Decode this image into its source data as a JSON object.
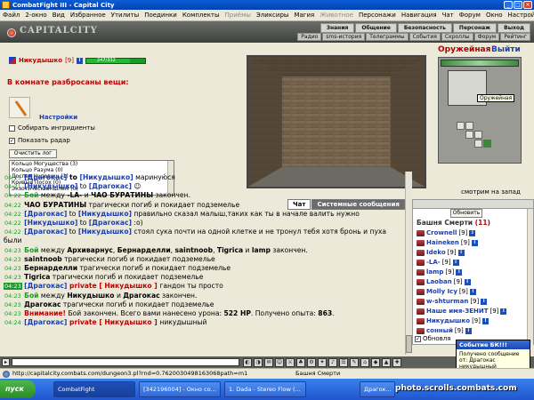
{
  "window": {
    "title": "CombatFight III - Capital City"
  },
  "menu": {
    "items": [
      {
        "label": "Файл",
        "enabled": true
      },
      {
        "label": "2-окно",
        "enabled": true
      },
      {
        "label": "Вид",
        "enabled": true
      },
      {
        "label": "Избранное",
        "enabled": true
      },
      {
        "label": "Утилиты",
        "enabled": true
      },
      {
        "label": "Поединки",
        "enabled": true
      },
      {
        "label": "Комплекты",
        "enabled": true
      },
      {
        "label": "Приёмы",
        "enabled": false
      },
      {
        "label": "Эликсиры",
        "enabled": true
      },
      {
        "label": "Магия",
        "enabled": true
      },
      {
        "label": "Животное",
        "enabled": false
      },
      {
        "label": "Персонажи",
        "enabled": true
      },
      {
        "label": "Навигация",
        "enabled": true
      },
      {
        "label": "Чат",
        "enabled": true
      },
      {
        "label": "Форум",
        "enabled": true
      },
      {
        "label": "Окно",
        "enabled": true
      },
      {
        "label": "Настройки",
        "enabled": true
      }
    ]
  },
  "header": {
    "logo": "CAPITALCITY",
    "nav_top": [
      "Знания",
      "Общение",
      "Безопасность",
      "Персонаж",
      "Выход"
    ],
    "nav_bottom": [
      "Радио",
      "sms-история",
      "Телеграммы",
      "События",
      "Скроллы",
      "Форум",
      "Рейтинг"
    ]
  },
  "player": {
    "name": "Никудышко",
    "level": "[9]",
    "hp_text": "247/332",
    "hp_fraction": 0.744
  },
  "room": {
    "items_title": "В комнате разбросаны вещи:",
    "settings_label": "Настройки",
    "collect_label": "Собирать ингридиенты",
    "radar_label": "Показать радар",
    "clear_log_label": "Очистить лог",
    "items": [
      "Кольцо Могущества (3)",
      "Кольцо Разума (0)",
      "Доспех Чудовищ (1)",
      "Кривый Посох (0)",
      "Экзотический Шлем (0)"
    ]
  },
  "view": {
    "weapon_label": "Оружейная",
    "exit_label": "Выйти",
    "tooltip": "Оружейная",
    "facing": "смотрим на запад"
  },
  "chat": {
    "tabs": [
      "Чат",
      "Системные сообщения"
    ],
    "messages": [
      {
        "time": "04:13",
        "parts": [
          [
            "b",
            "[Драгокас]"
          ],
          [
            "d",
            " to "
          ],
          [
            "b",
            "[Никудышко]"
          ],
          [
            "t",
            " мариную́ся"
          ]
        ]
      },
      {
        "time": "04:21",
        "parts": [
          [
            "b",
            "[Никудышко]"
          ],
          [
            "t",
            " to "
          ],
          [
            "b",
            "[Драгокас]"
          ],
          [
            "t",
            " ☺"
          ]
        ]
      },
      {
        "time": "04:22",
        "parts": [
          [
            "g",
            "Бой"
          ],
          [
            "t",
            " между "
          ],
          [
            "d",
            "-LA-"
          ],
          [
            "t",
            " и "
          ],
          [
            "d",
            "ЧАО БУРАТИНЫ"
          ],
          [
            "t",
            " закончен."
          ]
        ]
      },
      {
        "time": "04:22",
        "parts": [
          [
            "d",
            "ЧАО БУРАТИНЫ"
          ],
          [
            "t",
            " трагически погиб и покидает подземелье"
          ]
        ]
      },
      {
        "time": "04:22",
        "parts": [
          [
            "b",
            "[Драгокас]"
          ],
          [
            "t",
            " to "
          ],
          [
            "b",
            "[Никудышко]"
          ],
          [
            "t",
            " правильно сказал малыш,таких как ты в начале валить нужно"
          ]
        ]
      },
      {
        "time": "04:22",
        "parts": [
          [
            "b",
            "[Никудышко]"
          ],
          [
            "t",
            " to "
          ],
          [
            "b",
            "[Драгокас]"
          ],
          [
            "t",
            " :о)"
          ]
        ]
      },
      {
        "time": "04:22",
        "parts": [
          [
            "b",
            "[Драгокас]"
          ],
          [
            "t",
            " to "
          ],
          [
            "b",
            "[Никудышко]"
          ],
          [
            "t",
            " стоял сука почти на одной клетке и не тронул тебя хотя бронь и пуха"
          ]
        ]
      },
      {
        "time": "",
        "parts": [
          [
            "t",
            "были"
          ]
        ]
      },
      {
        "time": "04:23",
        "parts": [
          [
            "g",
            "Бой"
          ],
          [
            "t",
            " между "
          ],
          [
            "d",
            "Архиварнус"
          ],
          [
            "t",
            ", "
          ],
          [
            "d",
            "Бернарделли"
          ],
          [
            "t",
            ", "
          ],
          [
            "d",
            "saintnoob"
          ],
          [
            "t",
            ", "
          ],
          [
            "d",
            "Tigrica"
          ],
          [
            "t",
            " и "
          ],
          [
            "d",
            "lamp"
          ],
          [
            "t",
            " закончен."
          ]
        ]
      },
      {
        "time": "04:23",
        "parts": [
          [
            "d",
            "saintnoob"
          ],
          [
            "t",
            " трагически погиб и покидает подземелье"
          ]
        ]
      },
      {
        "time": "04:23",
        "parts": [
          [
            "d",
            "Бернарделли"
          ],
          [
            "t",
            " трагически погиб и покидает подземелье"
          ]
        ]
      },
      {
        "time": "04:23",
        "parts": [
          [
            "d",
            "Tigrica"
          ],
          [
            "t",
            " трагически погиб и покидает подземелье"
          ]
        ]
      },
      {
        "time": "04:23",
        "hl": true,
        "parts": [
          [
            "b",
            "[Драгокас]"
          ],
          [
            "r",
            " private [ Никудышко ] "
          ],
          [
            "t",
            "гандон ты просто"
          ]
        ]
      },
      {
        "time": "04:23",
        "parts": [
          [
            "g",
            "Бой"
          ],
          [
            "t",
            " между "
          ],
          [
            "d",
            "Никудышко"
          ],
          [
            "t",
            " и "
          ],
          [
            "d",
            "Драгокас"
          ],
          [
            "t",
            " закончен."
          ]
        ]
      },
      {
        "time": "04:23",
        "parts": [
          [
            "d",
            "Драгокас"
          ],
          [
            "t",
            " трагически погиб и покидает подземелье"
          ]
        ]
      },
      {
        "time": "04:23",
        "parts": [
          [
            "r",
            "Внимание!"
          ],
          [
            "t",
            " Бой закончен. Всего вами нанесено урона: "
          ],
          [
            "d",
            "522 HP"
          ],
          [
            "t",
            ". Получено опыта: "
          ],
          [
            "d",
            "863"
          ],
          [
            "t",
            "."
          ]
        ]
      },
      {
        "time": "04:24",
        "parts": [
          [
            "b",
            "[Драгокас]"
          ],
          [
            "r",
            " private [ Никудышко ] "
          ],
          [
            "t",
            "никудышный"
          ]
        ]
      }
    ]
  },
  "tower": {
    "refresh_label": "Обновить",
    "title": "Башня Смерти",
    "count": "(11)",
    "players": [
      {
        "name": "Crownell",
        "level": "[9]"
      },
      {
        "name": "Haineken",
        "level": "[9]"
      },
      {
        "name": "Ideko",
        "level": "[9]"
      },
      {
        "name": "-LA-",
        "level": "[9]"
      },
      {
        "name": "lamp",
        "level": "[9]"
      },
      {
        "name": "Laoban",
        "level": "[9]"
      },
      {
        "name": "Molly Icy",
        "level": "[9]"
      },
      {
        "name": "w-shturman",
        "level": "[9]"
      },
      {
        "name": "Наше имя-ЗЕНИТ",
        "level": "[9]"
      },
      {
        "name": "Никудышко",
        "level": "[9]"
      },
      {
        "name": "сонный",
        "level": "[9]"
      }
    ],
    "auto_label": "Обновля"
  },
  "notification": {
    "title": "Событие БК!!!",
    "body": "Получено сообщение от: Драгокас никудышный"
  },
  "statusbar": {
    "url": "http://capitalcity.combats.com/dungeon3.pl?rnd=0.7620030498163068path=m1",
    "right": "Башня Смерти"
  },
  "taskbar": {
    "start": "пуск",
    "tasks": [
      "CombatFight",
      "[342196004] - Окно со...",
      "1. Dada - Stereo Flow (...",
      "Драгок..."
    ]
  },
  "watermark": "photo.scrolls.combats.com"
}
